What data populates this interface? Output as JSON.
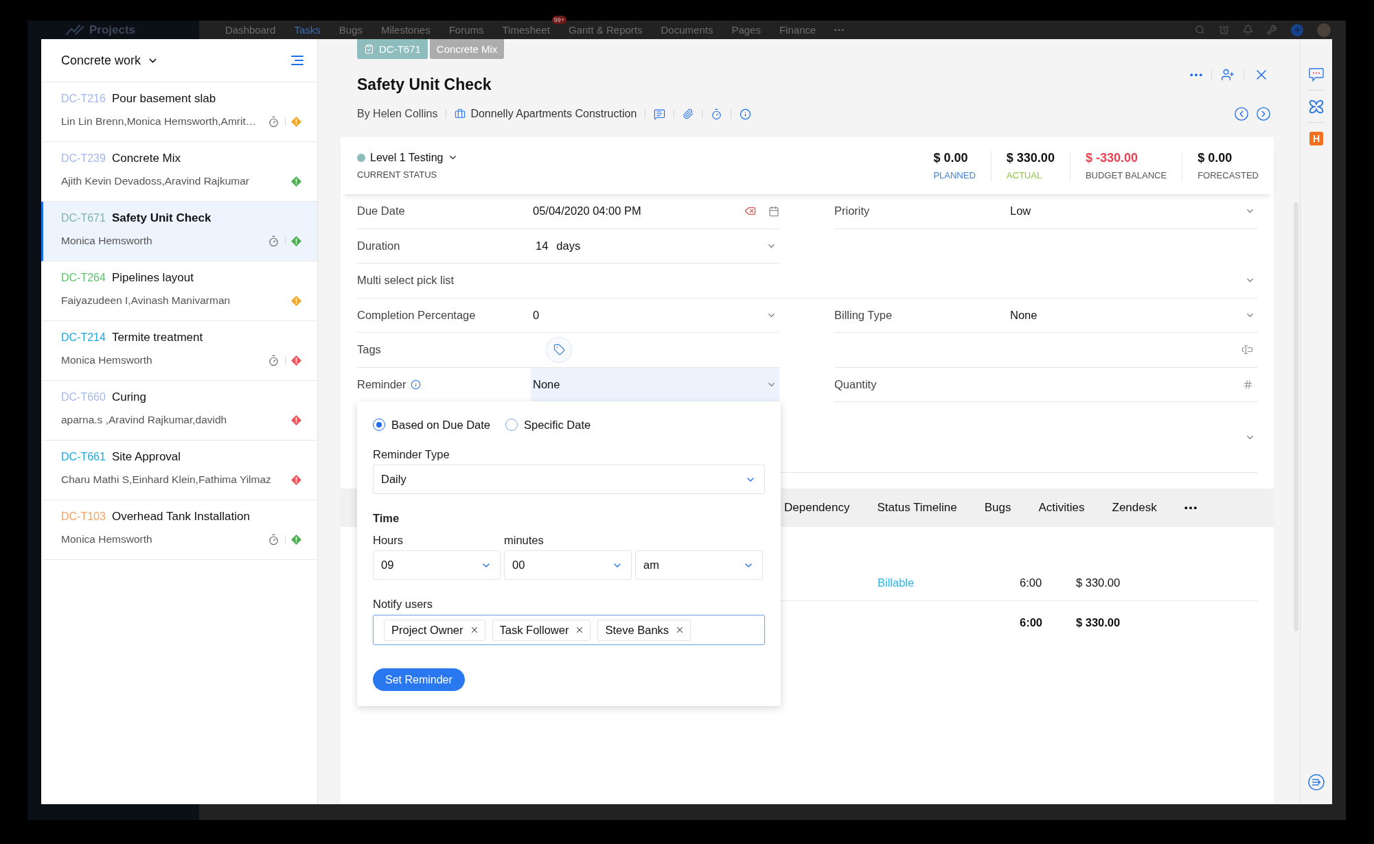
{
  "background_app": {
    "logo": "Projects",
    "nav": [
      {
        "label": "Dashboard",
        "selected": false
      },
      {
        "label": "Tasks",
        "selected": true
      },
      {
        "label": "Bugs",
        "selected": false
      },
      {
        "label": "Milestones",
        "selected": false
      },
      {
        "label": "Forums",
        "selected": false
      },
      {
        "label": "Timesheet",
        "selected": false,
        "badge": "99+"
      },
      {
        "label": "Gantt & Reports",
        "selected": false
      },
      {
        "label": "Documents",
        "selected": false
      },
      {
        "label": "Pages",
        "selected": false
      },
      {
        "label": "Finance",
        "selected": false
      }
    ]
  },
  "list": {
    "title": "Concrete work",
    "items": [
      {
        "id": "DC-T216",
        "title": "Pour basement slab",
        "assignees": "Lin Lin Brenn,Monica Hemsworth,Amrit…",
        "color": "#a4b7ea",
        "timer": true,
        "priority": {
          "color": "#f5a623"
        },
        "selected": false
      },
      {
        "id": "DC-T239",
        "title": "Concrete Mix",
        "assignees": "Ajith Kevin Devadoss,Aravind Rajkumar",
        "color": "#a4b7ea",
        "timer": false,
        "priority": {
          "color": "#4caf50"
        },
        "selected": false
      },
      {
        "id": "DC-T671",
        "title": "Safety Unit Check",
        "assignees": "Monica Hemsworth",
        "color": "#7fb2ae",
        "timer": true,
        "priority": {
          "color": "#4caf50"
        },
        "selected": true
      },
      {
        "id": "DC-T264",
        "title": "Pipelines layout",
        "assignees": "Faiyazudeen I,Avinash Manivarman",
        "color": "#5cc46a",
        "timer": false,
        "priority": {
          "color": "#f5a623"
        },
        "selected": false
      },
      {
        "id": "DC-T214",
        "title": "Termite treatment",
        "assignees": "Monica Hemsworth",
        "color": "#1ea7e1",
        "timer": true,
        "priority": {
          "color": "#f0545c"
        },
        "selected": false
      },
      {
        "id": "DC-T660",
        "title": "Curing",
        "assignees": "aparna.s ,Aravind Rajkumar,davidh",
        "color": "#a4b7ea",
        "timer": false,
        "priority": {
          "color": "#f0545c"
        },
        "selected": false
      },
      {
        "id": "DC-T661",
        "title": "Site Approval",
        "assignees": "Charu Mathi S,Einhard Klein,Fathima Yilmaz",
        "color": "#1ea7e1",
        "timer": false,
        "priority": {
          "color": "#f0545c"
        },
        "selected": false
      },
      {
        "id": "DC-T103",
        "title": "Overhead Tank Installation",
        "assignees": "Monica Hemsworth",
        "color": "#f4a262",
        "timer": true,
        "priority": {
          "color": "#4caf50"
        },
        "selected": false
      }
    ]
  },
  "task": {
    "chips": [
      {
        "label": "DC-T671",
        "kind": "task"
      },
      {
        "label": "Concrete Mix",
        "kind": "parent"
      }
    ],
    "title": "Safety Unit Check",
    "author": "By Helen Collins",
    "project": "Donnelly Apartments Construction"
  },
  "status": {
    "label": "Level 1 Testing",
    "caption": "CURRENT STATUS",
    "color": "#8dbcbc"
  },
  "stats": [
    {
      "value": "$ 0.00",
      "label": "PLANNED",
      "color": "#3b82d6",
      "negative": false
    },
    {
      "value": "$ 330.00",
      "label": "ACTUAL",
      "color": "#8cc63f",
      "negative": false
    },
    {
      "value": "$ -330.00",
      "label": "BUDGET BALANCE",
      "color": "#555555",
      "negative": true
    },
    {
      "value": "$ 0.00",
      "label": "FORECASTED",
      "color": "#555555",
      "negative": false
    }
  ],
  "fields": [
    {
      "kind": "datetime",
      "label": "Due Date",
      "value": "05/04/2020 04:00 PM",
      "wide": false,
      "info": false
    },
    {
      "kind": "dropdown",
      "label": "Priority",
      "value": "Low",
      "wide": false,
      "info": false,
      "expanded": false
    },
    {
      "kind": "duration",
      "label": "Duration",
      "value": "14",
      "unit": "days",
      "wide": false,
      "info": false,
      "expanded": false
    },
    {
      "kind": "dropdown",
      "label": "Multi select pick list",
      "wide": true,
      "info": false,
      "expanded": false
    },
    {
      "kind": "dropdown",
      "label": "Completion Percentage",
      "value": "0",
      "wide": false,
      "info": false,
      "expanded": false
    },
    {
      "kind": "dropdown",
      "label": "Billing Type",
      "value": "None",
      "wide": false,
      "info": false,
      "expanded": false
    },
    {
      "kind": "tags",
      "label": "Tags",
      "wide": false,
      "info": false
    },
    {
      "kind": "text",
      "wide": false,
      "info": false
    },
    {
      "kind": "dropdown",
      "label": "Reminder",
      "value": "None",
      "wide": false,
      "info": true,
      "expanded": true
    },
    {
      "kind": "number",
      "label": "Quantity",
      "wide": false,
      "info": false
    },
    {
      "kind": "tall_dropdown",
      "wide": true,
      "info": false,
      "expanded": false
    }
  ],
  "reminder_popup": {
    "options": [
      {
        "label": "Based on Due Date",
        "selected": true
      },
      {
        "label": "Specific Date",
        "selected": false
      }
    ],
    "type_label": "Reminder Type",
    "type_value": "Daily",
    "time_title": "Time",
    "time_selects": [
      {
        "label": "Hours",
        "value": "09"
      },
      {
        "label": "minutes",
        "value": "00"
      },
      {
        "value": "am"
      }
    ],
    "notify_label": "Notify users",
    "notify_users": [
      "Project Owner",
      "Task Follower",
      "Steve Banks"
    ],
    "button": "Set Reminder"
  },
  "tabs": [
    "Dependency",
    "Status Timeline",
    "Bugs",
    "Activities",
    "Zendesk"
  ],
  "table": {
    "rows": [
      {
        "column_1": "Billable",
        "column_2": "6:00",
        "column_3": "$ 330.00"
      }
    ],
    "total": {
      "column_2": "6:00",
      "column_3": "$ 330.00"
    }
  },
  "rail": [
    {
      "kind": "chat"
    },
    {
      "kind": "clover"
    },
    {
      "kind": "logo",
      "label": "H"
    }
  ]
}
